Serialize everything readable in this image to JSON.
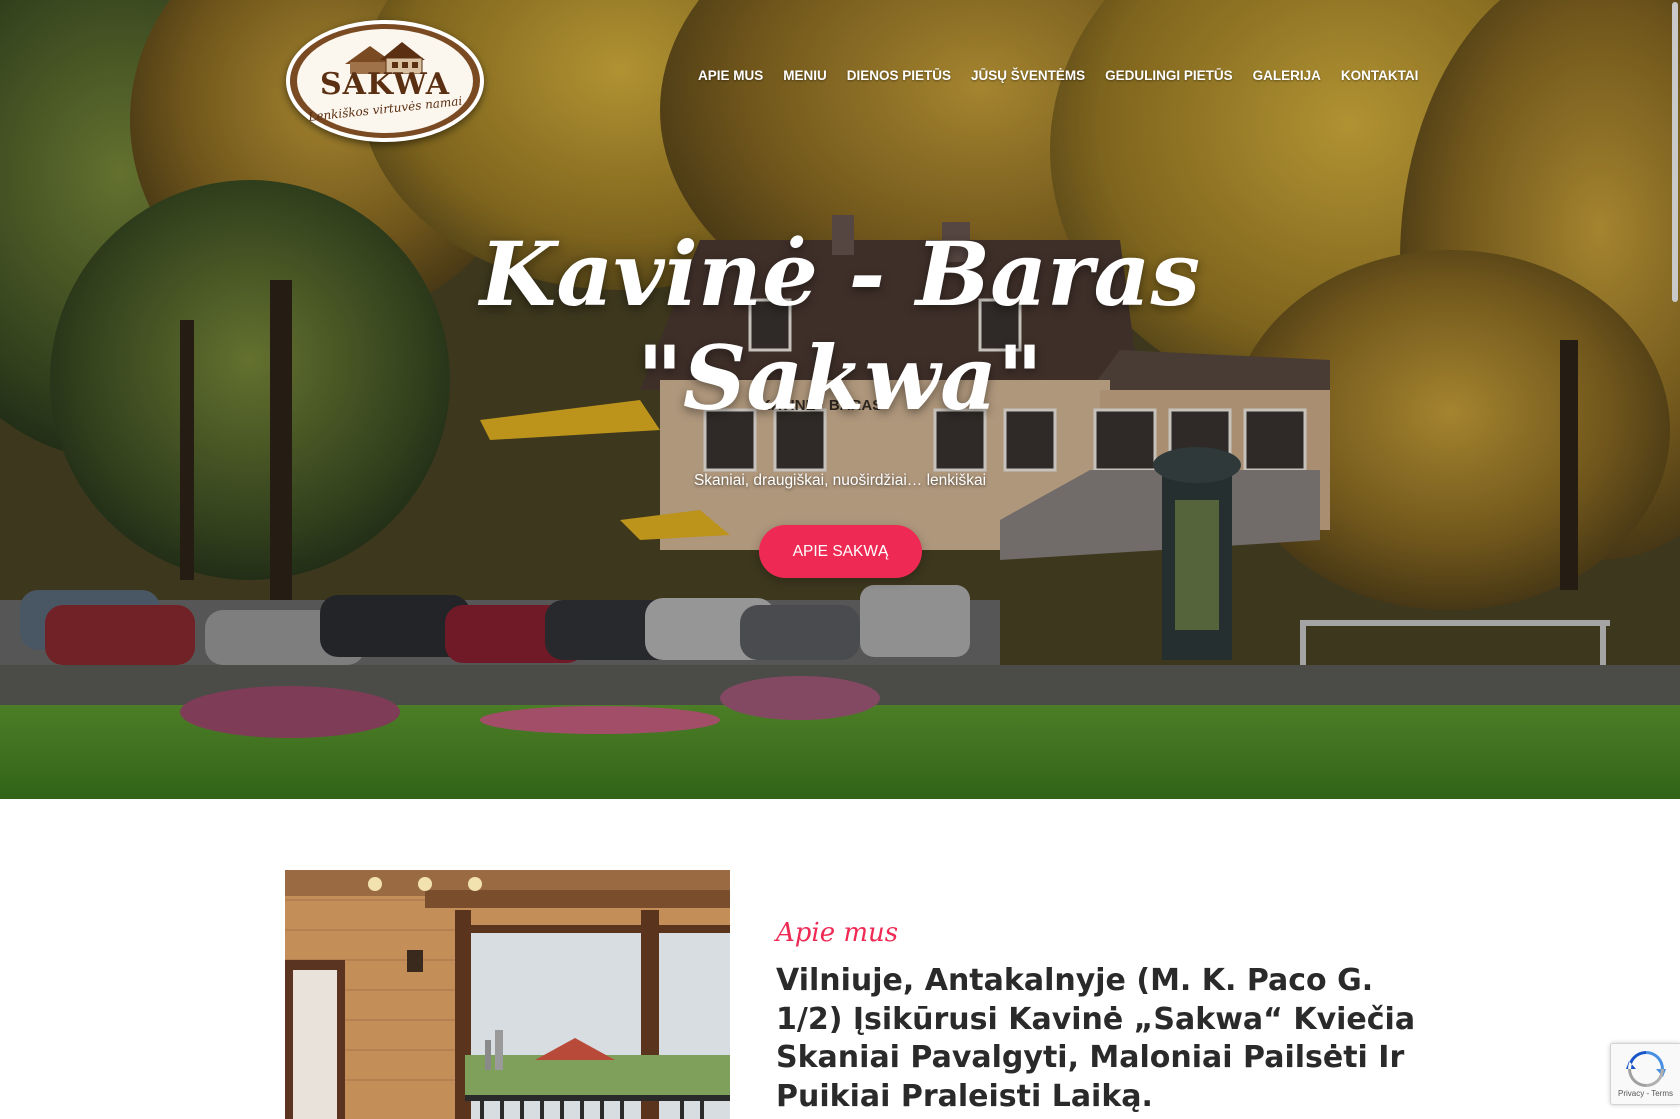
{
  "header": {
    "logo": {
      "name": "SAKWA",
      "tagline": "Lenkiškos virtuvės namai"
    },
    "nav": [
      {
        "label": "APIE MUS"
      },
      {
        "label": "MENIU"
      },
      {
        "label": "DIENOS PIETŪS"
      },
      {
        "label": "JŪSŲ ŠVENTĖMS"
      },
      {
        "label": "GEDULINGI PIETŪS"
      },
      {
        "label": "GALERIJA"
      },
      {
        "label": "KONTAKTAI"
      }
    ]
  },
  "hero": {
    "title_line1": "Kavinė - Baras",
    "title_line2": "\"Sakwa\"",
    "subtitle": "Skaniai, draugiškai, nuoširdžiai… lenkiškai",
    "button_label": "APIE SAKWĄ",
    "sign_text": "KAVINĖ · BARAS"
  },
  "about": {
    "kicker": "Apie mus",
    "heading": "Vilniuje, Antakalnyje (M. K. Paco G. 1/2) Įsikūrusi Kavinė „Sakwa“ Kviečia Skaniai Pavalgyti, Maloniai Pailsėti Ir Puikiai Praleisti Laiką."
  },
  "recaptcha": {
    "terms": "Privacy - Terms"
  },
  "colors": {
    "accent": "#ee2a54",
    "heading": "#2a2a2a",
    "logo_brown": "#5a2f12"
  }
}
